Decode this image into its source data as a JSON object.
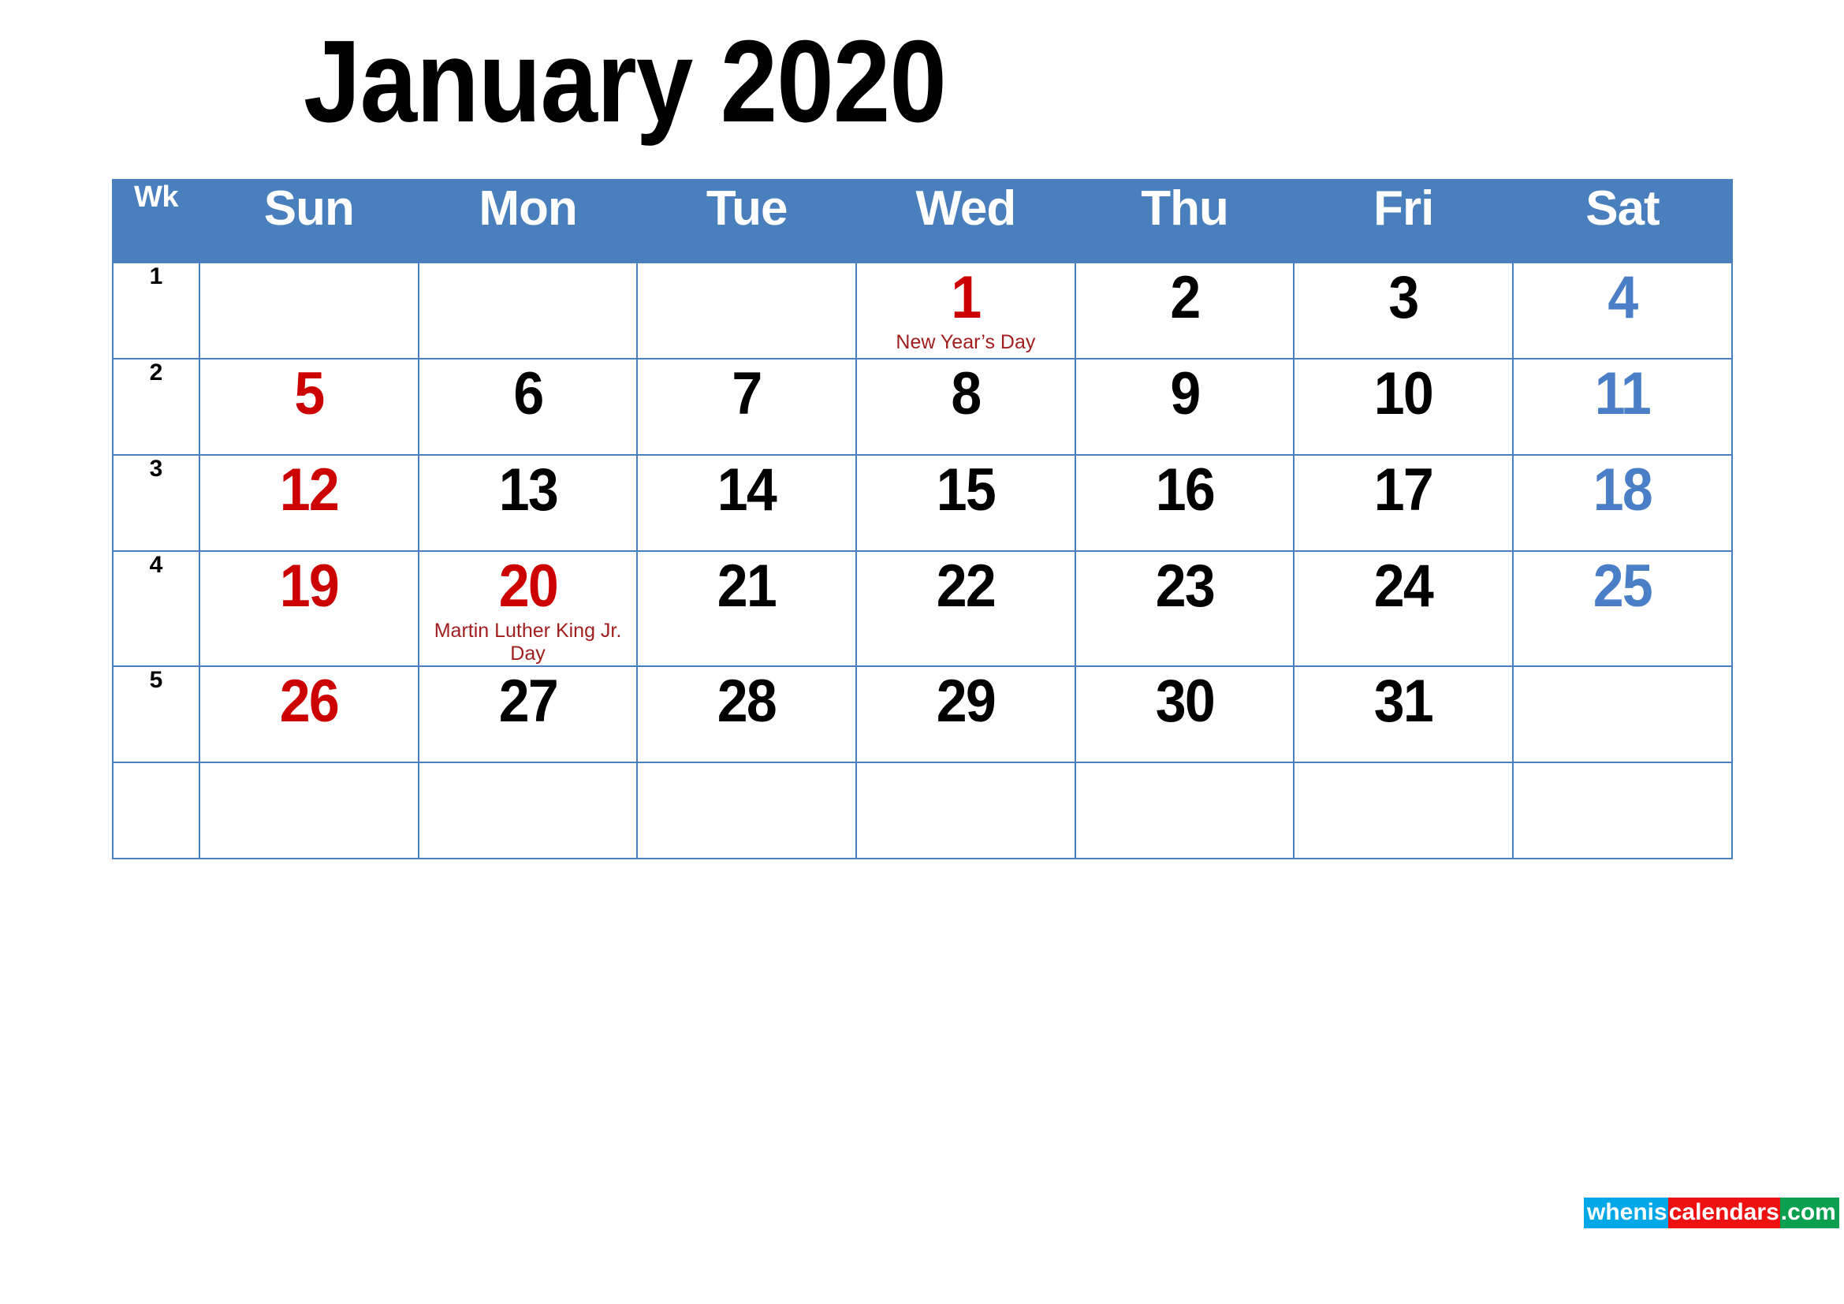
{
  "title": "January 2020",
  "colors": {
    "header_bg": "#4a7fbd",
    "border": "#4a7fbd",
    "sunday": "#cc0000",
    "saturday": "#4a7ec6",
    "weekday": "#000000",
    "holiday_label": "#a01e1e",
    "logo_blue": "#00a8e8",
    "logo_red": "#ee1111",
    "logo_green": "#0aa050"
  },
  "header": {
    "wk_label": "Wk",
    "days": [
      "Sun",
      "Mon",
      "Tue",
      "Wed",
      "Thu",
      "Fri",
      "Sat"
    ]
  },
  "weeks": [
    {
      "wk": "1",
      "days": [
        {
          "num": "",
          "event": "",
          "kind": "empty"
        },
        {
          "num": "",
          "event": "",
          "kind": "empty"
        },
        {
          "num": "",
          "event": "",
          "kind": "empty"
        },
        {
          "num": "1",
          "event": "New Year’s Day",
          "kind": "holiday"
        },
        {
          "num": "2",
          "event": "",
          "kind": "weekday"
        },
        {
          "num": "3",
          "event": "",
          "kind": "weekday"
        },
        {
          "num": "4",
          "event": "",
          "kind": "sat"
        }
      ]
    },
    {
      "wk": "2",
      "days": [
        {
          "num": "5",
          "event": "",
          "kind": "sun"
        },
        {
          "num": "6",
          "event": "",
          "kind": "weekday"
        },
        {
          "num": "7",
          "event": "",
          "kind": "weekday"
        },
        {
          "num": "8",
          "event": "",
          "kind": "weekday"
        },
        {
          "num": "9",
          "event": "",
          "kind": "weekday"
        },
        {
          "num": "10",
          "event": "",
          "kind": "weekday"
        },
        {
          "num": "11",
          "event": "",
          "kind": "sat"
        }
      ]
    },
    {
      "wk": "3",
      "days": [
        {
          "num": "12",
          "event": "",
          "kind": "sun"
        },
        {
          "num": "13",
          "event": "",
          "kind": "weekday"
        },
        {
          "num": "14",
          "event": "",
          "kind": "weekday"
        },
        {
          "num": "15",
          "event": "",
          "kind": "weekday"
        },
        {
          "num": "16",
          "event": "",
          "kind": "weekday"
        },
        {
          "num": "17",
          "event": "",
          "kind": "weekday"
        },
        {
          "num": "18",
          "event": "",
          "kind": "sat"
        }
      ]
    },
    {
      "wk": "4",
      "days": [
        {
          "num": "19",
          "event": "",
          "kind": "sun"
        },
        {
          "num": "20",
          "event": "Martin Luther King Jr. Day",
          "kind": "holiday"
        },
        {
          "num": "21",
          "event": "",
          "kind": "weekday"
        },
        {
          "num": "22",
          "event": "",
          "kind": "weekday"
        },
        {
          "num": "23",
          "event": "",
          "kind": "weekday"
        },
        {
          "num": "24",
          "event": "",
          "kind": "weekday"
        },
        {
          "num": "25",
          "event": "",
          "kind": "sat"
        }
      ]
    },
    {
      "wk": "5",
      "days": [
        {
          "num": "26",
          "event": "",
          "kind": "sun"
        },
        {
          "num": "27",
          "event": "",
          "kind": "weekday"
        },
        {
          "num": "28",
          "event": "",
          "kind": "weekday"
        },
        {
          "num": "29",
          "event": "",
          "kind": "weekday"
        },
        {
          "num": "30",
          "event": "",
          "kind": "weekday"
        },
        {
          "num": "31",
          "event": "",
          "kind": "weekday"
        },
        {
          "num": "",
          "event": "",
          "kind": "empty"
        }
      ]
    },
    {
      "wk": "",
      "days": [
        {
          "num": "",
          "event": "",
          "kind": "empty"
        },
        {
          "num": "",
          "event": "",
          "kind": "empty"
        },
        {
          "num": "",
          "event": "",
          "kind": "empty"
        },
        {
          "num": "",
          "event": "",
          "kind": "empty"
        },
        {
          "num": "",
          "event": "",
          "kind": "empty"
        },
        {
          "num": "",
          "event": "",
          "kind": "empty"
        },
        {
          "num": "",
          "event": "",
          "kind": "empty"
        }
      ]
    }
  ],
  "logo": {
    "part1": "whenis",
    "part2": "calendars",
    "part3": ".com"
  }
}
